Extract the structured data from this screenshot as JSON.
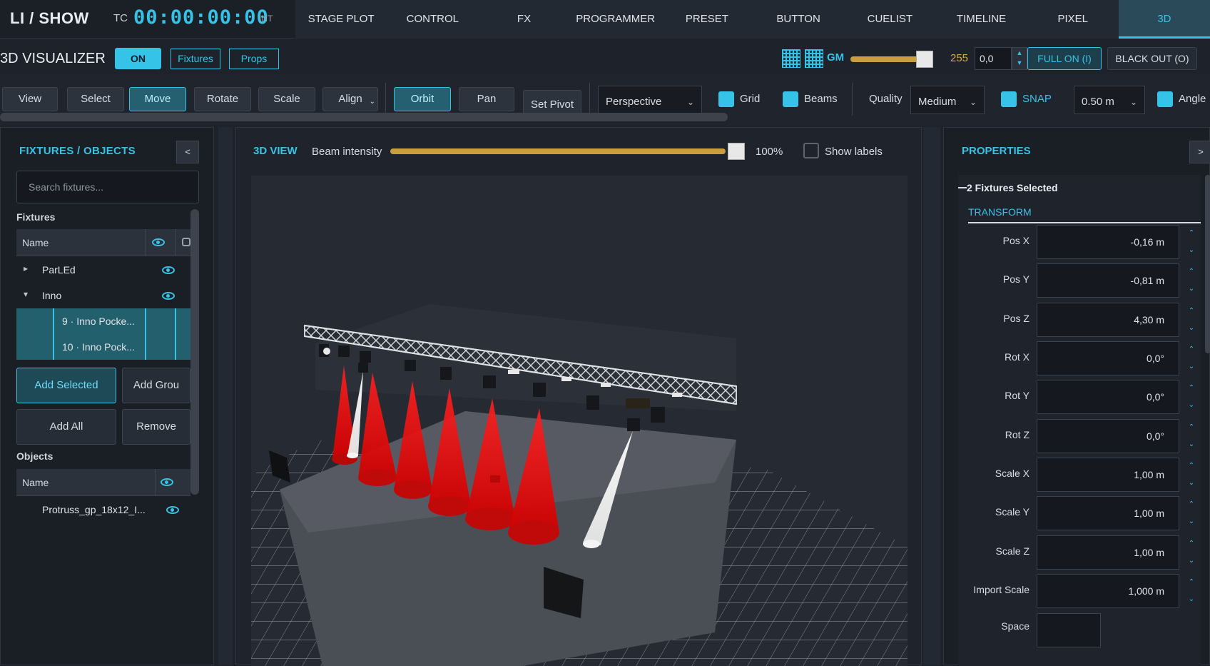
{
  "header": {
    "brand": "LI / SHOW",
    "tc_label": "TC",
    "timecode": "00:00:00:00",
    "tc_mode": "INT",
    "tabs": [
      {
        "label": "STAGE PLOT"
      },
      {
        "label": "CONTROL"
      },
      {
        "label": "FX"
      },
      {
        "label": "PROGRAMMER"
      },
      {
        "label": "PRESET"
      },
      {
        "label": "BUTTON"
      },
      {
        "label": "CUELIST"
      },
      {
        "label": "TIMELINE"
      },
      {
        "label": "PIXEL"
      },
      {
        "label": "3D"
      }
    ],
    "active_tab": "3D"
  },
  "visualizer_bar": {
    "title": "3D VISUALIZER",
    "on_label": "ON",
    "fixtures_label": "Fixtures",
    "props_label": "Props",
    "gm_label": "GM",
    "gm_value": "255",
    "gm_level_fraction": 1.0,
    "gm_input": "0,0",
    "full_on_label": "FULL ON (I)",
    "black_out_label": "BLACK OUT (O)"
  },
  "toolbar": {
    "view": "View",
    "select": "Select",
    "move": "Move",
    "rotate": "Rotate",
    "scale": "Scale",
    "align": "Align",
    "orbit": "Orbit",
    "pan": "Pan",
    "set_pivot": "Set Pivot",
    "projection": "Perspective",
    "grid": "Grid",
    "beams": "Beams",
    "quality_label": "Quality",
    "quality_value": "Medium",
    "snap": "SNAP",
    "snap_value": "0.50 m",
    "angle": "Angle"
  },
  "left_panel": {
    "title": "FIXTURES / OBJECTS",
    "collapse": "<",
    "search_placeholder": "Search fixtures...",
    "fixtures_label": "Fixtures",
    "name_header": "Name",
    "fixtures": [
      {
        "label": "ParLEd",
        "expander": "▸"
      },
      {
        "label": "Inno",
        "expander": "▾"
      },
      {
        "label": "9 · Inno Pocke..."
      },
      {
        "label": "10 · Inno Pock..."
      }
    ],
    "add_selected": "Add Selected",
    "add_group": "Add Grou",
    "add_all": "Add All",
    "remove": "Remove",
    "objects_label": "Objects",
    "objects": [
      {
        "label": "Protruss_gp_18x12_I..."
      }
    ]
  },
  "center_panel": {
    "title": "3D VIEW",
    "beam_label": "Beam intensity",
    "beam_value": "100%",
    "beam_level_fraction": 1.0,
    "show_labels": "Show labels"
  },
  "right_panel": {
    "title": "PROPERTIES",
    "expand": ">",
    "selection": "2 Fixtures Selected",
    "section": "TRANSFORM",
    "fields": [
      {
        "label": "Pos X",
        "value": "-0,16 m"
      },
      {
        "label": "Pos Y",
        "value": "-0,81 m"
      },
      {
        "label": "Pos Z",
        "value": "4,30 m"
      },
      {
        "label": "Rot X",
        "value": "0,0°"
      },
      {
        "label": "Rot Y",
        "value": "0,0°"
      },
      {
        "label": "Rot Z",
        "value": "0,0°"
      },
      {
        "label": "Scale X",
        "value": "1,00 m"
      },
      {
        "label": "Scale Y",
        "value": "1,00 m"
      },
      {
        "label": "Scale Z",
        "value": "1,00 m"
      },
      {
        "label": "Import Scale",
        "value": "1,000 m"
      },
      {
        "label": "Space",
        "value": ""
      }
    ]
  },
  "colors": {
    "accent": "#35c3e8",
    "gm_gold": "#c99e3c",
    "beam_red": "#e01414"
  }
}
